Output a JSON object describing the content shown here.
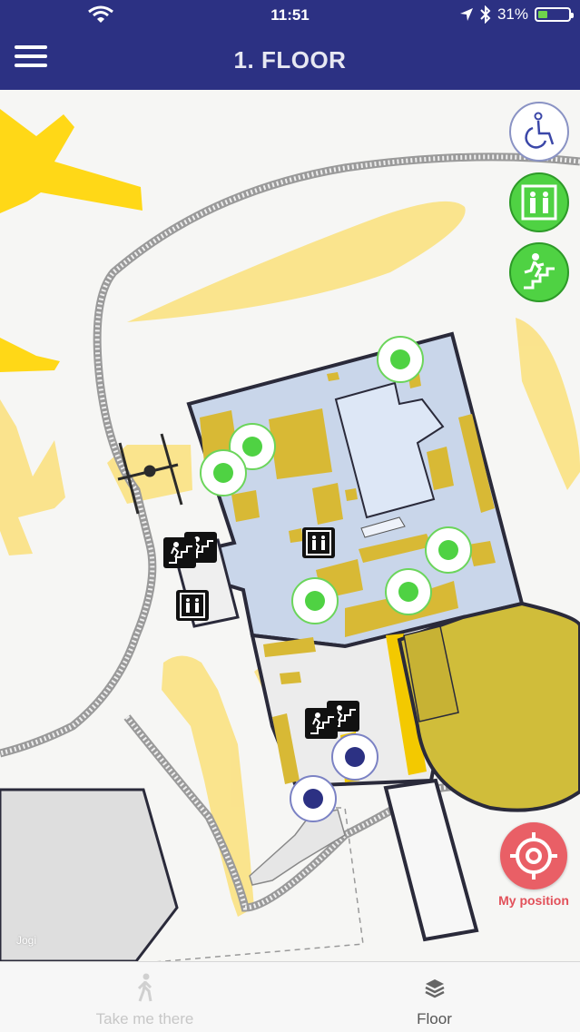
{
  "status_bar": {
    "time": "11:51",
    "battery_percent": "31%",
    "battery_level": 0.31,
    "icons": [
      "wifi-icon",
      "location-arrow-icon",
      "bluetooth-icon",
      "battery-icon"
    ]
  },
  "nav_bar": {
    "title": "1. FLOOR",
    "menu_icon": "hamburger-menu-icon"
  },
  "map": {
    "filters": [
      {
        "name": "accessible",
        "icon": "wheelchair-icon",
        "active": false
      },
      {
        "name": "elevator",
        "icon": "elevator-icon",
        "active": true
      },
      {
        "name": "stairs",
        "icon": "stairs-icon",
        "active": true
      }
    ],
    "attribution": "Jogi",
    "colors": {
      "header": "#2c3183",
      "building": "#c9d6ea",
      "poi_active": "#4fd243",
      "poi_location": "#2c3183",
      "yellow": "#ffd817",
      "my_position": "#e95f66"
    }
  },
  "my_position": {
    "label": "My position",
    "icon": "crosshair-icon"
  },
  "tab_bar": {
    "tabs": [
      {
        "label": "Take me there",
        "icon": "walking-person-icon",
        "enabled": false
      },
      {
        "label": "Floor",
        "icon": "layers-icon",
        "enabled": true
      }
    ]
  }
}
